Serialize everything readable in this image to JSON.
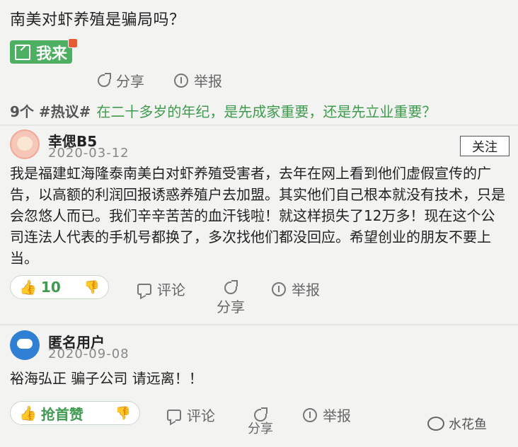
{
  "question": {
    "title": "南美对虾养殖是骗局吗？"
  },
  "me_button": {
    "label": "我来"
  },
  "question_actions": {
    "share": "分享",
    "report": "举报"
  },
  "topic": {
    "count_prefix": "9个 #热议#",
    "text": "在二十多岁的年纪，是先成家重要，还是先立业重要？"
  },
  "answers": [
    {
      "user": "幸偲B5",
      "date": "2020-03-12",
      "follow": "关注",
      "text": "我是福建虹海隆泰南美白对虾养殖受害者，去年在网上看到他们虚假宣传的广告，以高额的利润回报诱惑养殖户去加盟。其实他们自己根本就没有技术，只是会忽悠人而已。我们辛辛苦苦的血汗钱啦！就这样损失了12万多！现在这个公司连法人代表的手机号都换了，多次找他们都没回应。希望创业的朋友不要上当。",
      "likes": "10",
      "comment": "评论",
      "share": "分享",
      "report": "举报"
    },
    {
      "user": "匿名用户",
      "date": "2020-09-08",
      "text": "裕海弘正 骗子公司 请远离！！",
      "likes": "抢首赞",
      "comment": "评论",
      "share": "分享",
      "report": "举报"
    }
  ],
  "watermark": {
    "text": "水花鱼"
  },
  "colors": {
    "accent": "#4caf62",
    "topic": "#3f9a4f",
    "background": "#f3f4f1"
  }
}
